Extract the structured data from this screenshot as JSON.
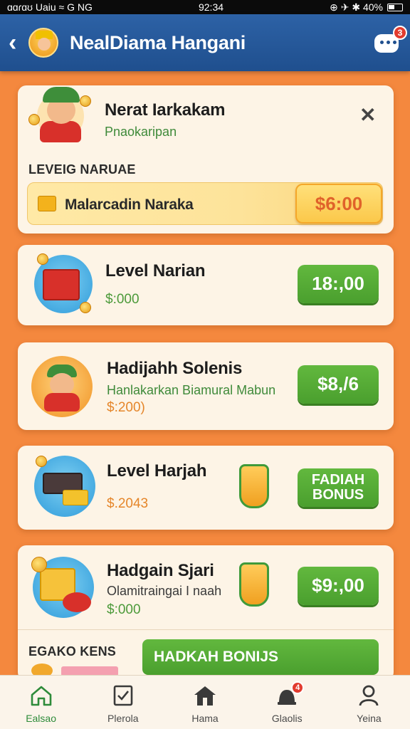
{
  "status_bar": {
    "left": "ɑɑɾɑʊ Uaiu ≈ G NG",
    "time": "92:34",
    "right": "⊕ ✈ ✱ 40%"
  },
  "header": {
    "title": "NealDiama Hangani",
    "chat_badge": "3"
  },
  "profile_card": {
    "name": "Nerat Iarkakam",
    "subtitle": "Pnaokaripan",
    "section_label": "LEVEIG NARUAE",
    "bar_label": "Malarcadin Naraka",
    "bar_value": "$6:00",
    "close_symbol": "✕"
  },
  "rewards": [
    {
      "title": "Level Narian",
      "subtitle": "",
      "amount": "$:000",
      "amount_color": "green",
      "button": "18:,00"
    },
    {
      "title": "Hadijahh Solenis",
      "subtitle": "Hanlakarkan Biamural Mabun",
      "amount": "$:200)",
      "amount_color": "orange",
      "button": "$8,/6"
    },
    {
      "title": "Level Harjah",
      "subtitle": "",
      "amount": "$.2043",
      "amount_color": "orange",
      "button": "FADIAH BONUS"
    },
    {
      "title": "Hadgain Sjari",
      "subtitle": "Olamitraingai I naah",
      "amount": "$:000",
      "amount_color": "green",
      "button": "$9:,00"
    }
  ],
  "bottom_section": {
    "label": "EGAKO KENS",
    "bonus_button": "HADKAH BONIJS"
  },
  "nav": [
    {
      "label": "Ealsao",
      "icon": "home-icon",
      "active": true
    },
    {
      "label": "Plerola",
      "icon": "checklist-icon",
      "active": false
    },
    {
      "label": "Hama",
      "icon": "house-icon",
      "active": false
    },
    {
      "label": "Glaolis",
      "icon": "bell-icon",
      "active": false,
      "badge": "4"
    },
    {
      "label": "Yeina",
      "icon": "profile-icon",
      "active": false
    }
  ],
  "colors": {
    "background": "#f4883e",
    "header": "#2d62a6",
    "green": "#4a9f2e",
    "gold": "#fbc84a"
  }
}
